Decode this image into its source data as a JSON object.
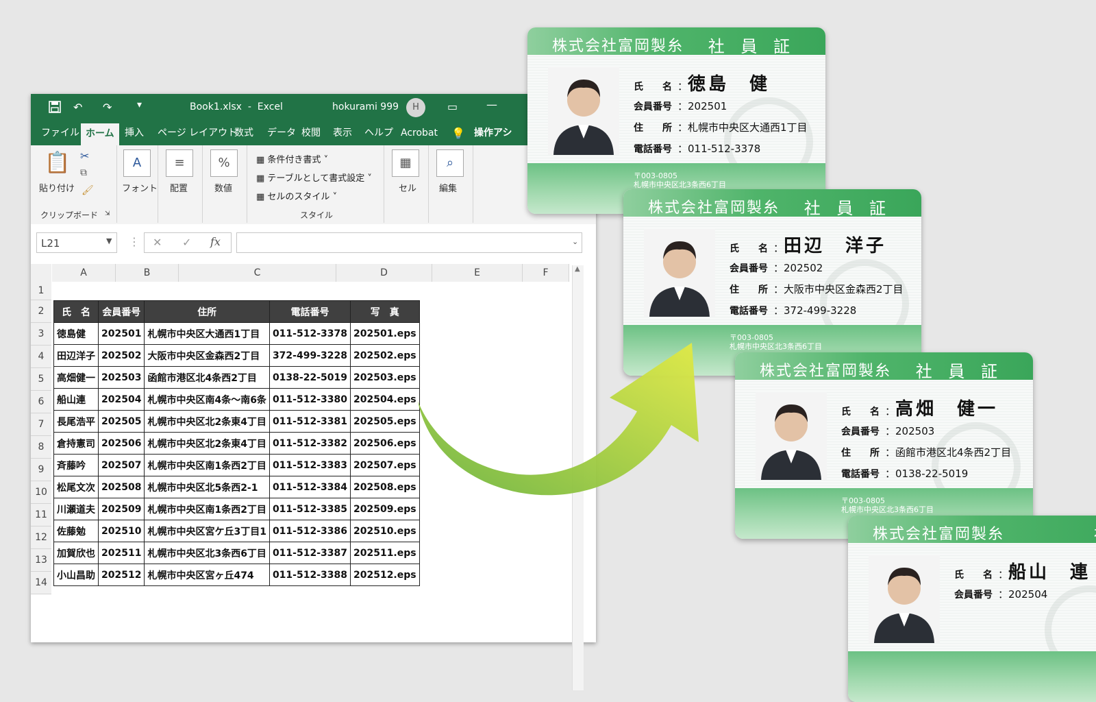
{
  "excel": {
    "file_title": "Book1.xlsx  -  Excel",
    "user": "hokurami 999",
    "avatar_initial": "H",
    "tabs": [
      "ファイル",
      "ホーム",
      "挿入",
      "ページ レイアウト",
      "数式",
      "データ",
      "校閲",
      "表示",
      "ヘルプ",
      "Acrobat",
      "操作アシ"
    ],
    "ribbon": {
      "paste": "貼り付け",
      "clipboard": "クリップボード",
      "font": "フォント",
      "align": "配置",
      "number": "数値",
      "cond_format": "条件付き書式",
      "table_format": "テーブルとして書式設定",
      "cell_style": "セルのスタイル",
      "styles": "スタイル",
      "cell": "セル",
      "edit": "編集"
    },
    "name_box": "L21",
    "columns": [
      "A",
      "B",
      "C",
      "D",
      "E",
      "F"
    ],
    "rows": [
      "1",
      "2",
      "3",
      "4",
      "5",
      "6",
      "7",
      "8",
      "9",
      "10",
      "11",
      "12",
      "13",
      "14"
    ],
    "headers": [
      "氏　名",
      "会員番号",
      "住所",
      "電話番号",
      "写　真"
    ],
    "data": [
      [
        "徳島健",
        "202501",
        "札幌市中央区大通西1丁目",
        "011-512-3378",
        "202501.eps"
      ],
      [
        "田辺洋子",
        "202502",
        "大阪市中央区金森西2丁目",
        "372-499-3228",
        "202502.eps"
      ],
      [
        "高畑健一",
        "202503",
        "函館市港区北4条西2丁目",
        "0138-22-5019",
        "202503.eps"
      ],
      [
        "船山連",
        "202504",
        "札幌市中央区南4条～南6条",
        "011-512-3380",
        "202504.eps"
      ],
      [
        "長尾浩平",
        "202505",
        "札幌市中央区北2条東4丁目",
        "011-512-3381",
        "202505.eps"
      ],
      [
        "倉持憲司",
        "202506",
        "札幌市中央区北2条東4丁目",
        "011-512-3382",
        "202506.eps"
      ],
      [
        "斉藤吟",
        "202507",
        "札幌市中央区南1条西2丁目",
        "011-512-3383",
        "202507.eps"
      ],
      [
        "松尾文次",
        "202508",
        "札幌市中央区北5条西2-1",
        "011-512-3384",
        "202508.eps"
      ],
      [
        "川瀬道夫",
        "202509",
        "札幌市中央区南1条西2丁目",
        "011-512-3385",
        "202509.eps"
      ],
      [
        "佐藤勉",
        "202510",
        "札幌市中央区宮ケ丘3丁目1",
        "011-512-3386",
        "202510.eps"
      ],
      [
        "加賀欣也",
        "202511",
        "札幌市中央区北3条西6丁目",
        "011-512-3387",
        "202511.eps"
      ],
      [
        "小山昌助",
        "202512",
        "札幌市中央区宮ヶ丘474",
        "011-512-3388",
        "202512.eps"
      ]
    ]
  },
  "cards": [
    {
      "company": "株式会社富岡製糸",
      "title": "社 員 証",
      "name": "徳島　健",
      "number": "202501",
      "address": "札幌市中央区大通西1丁目",
      "phone": "011-512-3378",
      "footer_zip": "〒003-0805",
      "footer_addr": "札幌市中央区北3条西6丁目"
    },
    {
      "company": "株式会社富岡製糸",
      "title": "社 員 証",
      "name": "田辺　洋子",
      "number": "202502",
      "address": "大阪市中央区金森西2丁目",
      "phone": "372-499-3228",
      "footer_zip": "〒003-0805",
      "footer_addr": "札幌市中央区北3条西6丁目"
    },
    {
      "company": "株式会社富岡製糸",
      "title": "社 員 証",
      "name": "高畑　健一",
      "number": "202503",
      "address": "函館市港区北4条西2丁目",
      "phone": "0138-22-5019",
      "footer_zip": "〒003-0805",
      "footer_addr": "札幌市中央区北3条西6丁目"
    },
    {
      "company": "株式会社富岡製糸",
      "title": "社",
      "name": "船山　連",
      "number": "202504"
    }
  ],
  "card_labels": {
    "name": "氏　　名",
    "number": "会員番号",
    "address": "住　　所",
    "phone": "電話番号"
  },
  "colors": {
    "excel_green": "#217346",
    "card_green": "#3aa65a",
    "arrow_start": "#8cc63f",
    "arrow_end": "#d9e84a"
  }
}
